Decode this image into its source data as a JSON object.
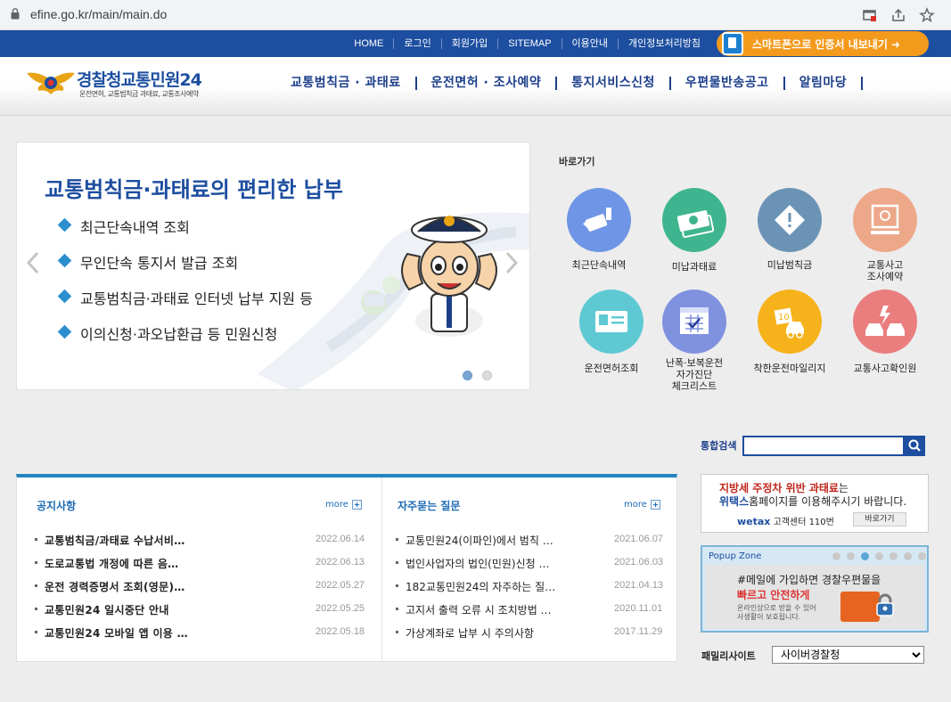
{
  "browser": {
    "url": "efine.go.kr/main/main.do"
  },
  "topbar": {
    "links": [
      "HOME",
      "로그인",
      "회원가입",
      "SITEMAP",
      "이용안내",
      "개인정보처리방침"
    ],
    "smart_button": "스마트폰으로 인증서 내보내기 ➜"
  },
  "header": {
    "logo_title_a": "경찰청",
    "logo_title_b": "교통민원24",
    "logo_subtitle": "운전면허, 교통범칙금 과태료, 교통조사예약",
    "gnb": [
      "교통범칙금 · 과태료",
      "운전면허 · 조사예약",
      "통지서비스신청",
      "우편물반송공고",
      "알림마당"
    ]
  },
  "slider": {
    "title": "교통범칙금·과태료의 편리한 납부",
    "items": [
      "최근단속내역 조회",
      "무인단속 통지서 발급 조회",
      "교통범칙금·과태료 인터넷 납부 지원 등",
      "이의신청·과오납환급 등 민원신청"
    ]
  },
  "quick": {
    "title": "바로가기",
    "items": [
      {
        "label": "최근단속내역",
        "color": "#6f95e6",
        "icon": "cctv-icon"
      },
      {
        "label": "미납과태료",
        "color": "#3fb58f",
        "icon": "money-icon"
      },
      {
        "label": "미납범칙금",
        "color": "#6a93b6",
        "icon": "warning-icon"
      },
      {
        "label": "교통사고\n조사예약",
        "color": "#eca889",
        "icon": "computer-icon"
      },
      {
        "label": "운전면허조회",
        "color": "#5fc9d3",
        "icon": "license-card-icon"
      },
      {
        "label": "난폭·보복운전\n자가진단\n체크리스트",
        "color": "#7f91df",
        "icon": "calendar-check-icon"
      },
      {
        "label": "착한운전마일리지",
        "color": "#f6b21a",
        "icon": "mileage-car-icon"
      },
      {
        "label": "교통사고확인원",
        "color": "#ea7e7e",
        "icon": "car-accident-icon"
      }
    ]
  },
  "search": {
    "label": "통합검색",
    "value": ""
  },
  "notice": {
    "title": "공지사항",
    "more": "more",
    "rows": [
      {
        "title": "교통범칙금/과태료 수납서비…",
        "date": "2022.06.14"
      },
      {
        "title": "도로교통법 개정에 따른 음…",
        "date": "2022.06.13"
      },
      {
        "title": "운전 경력증명서 조회(영문)…",
        "date": "2022.05.27"
      },
      {
        "title": "교통민원24 일시중단 안내",
        "date": "2022.05.25"
      },
      {
        "title": "교통민원24 모바일 앱 이용 …",
        "date": "2022.05.18"
      }
    ]
  },
  "faq": {
    "title": "자주묻는 질문",
    "more": "more",
    "rows": [
      {
        "title": "교통민원24(이파인)에서 범칙 …",
        "date": "2021.06.07"
      },
      {
        "title": "법인사업자의 법인(민원)신청 …",
        "date": "2021.06.03"
      },
      {
        "title": "182교통민원24의 자주하는 질…",
        "date": "2021.04.13"
      },
      {
        "title": "고지서 출력 오류 시 조치방법 …",
        "date": "2020.11.01"
      },
      {
        "title": "가상계좌로 납부 시 주의사항",
        "date": "2017.11.29"
      }
    ]
  },
  "banner": {
    "line1_red": "지방세 주정차 위반 과태료",
    "line1_rest": "는",
    "line2_blue": "위택스",
    "line2_rest": "홈페이지를 이용해주시기 바랍니다.",
    "wetax": "wetax",
    "call": "고객센터 110번",
    "button": "바로가기"
  },
  "popup": {
    "title": "Popup Zone",
    "line1": "#메일에 가입하면 경찰우편물을",
    "line2": "빠르고 안전하게",
    "line3": "온라인상으로 받을 수 있어",
    "line4": "사생활이 보호됩니다."
  },
  "family": {
    "label": "패밀리사이트",
    "selected": "사이버경찰청"
  }
}
